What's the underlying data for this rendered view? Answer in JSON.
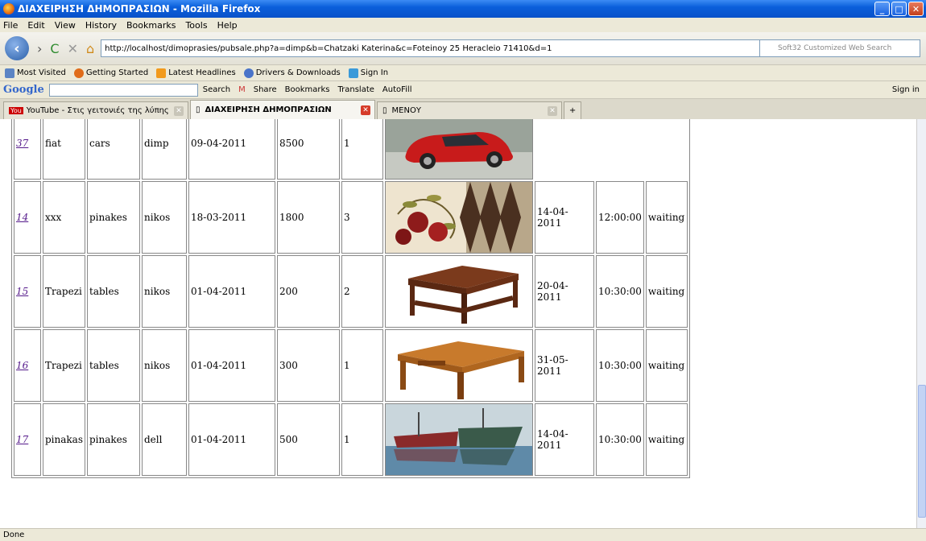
{
  "window": {
    "title": "ΔΙΑΧΕΙΡΗΣΗ ΔΗΜΟΠΡΑΣΙΩΝ - Mozilla Firefox"
  },
  "menu": [
    "File",
    "Edit",
    "View",
    "History",
    "Bookmarks",
    "Tools",
    "Help"
  ],
  "url": "http://localhost/dimoprasies/pubsale.php?a=dimp&b=Chatzaki Katerina&c=Foteinoy 25 Heracleio 71410&d=1",
  "search_placeholder": "Soft32 Customized Web Search",
  "bookmarks": [
    "Most Visited",
    "Getting Started",
    "Latest Headlines",
    "Drivers & Downloads",
    "Sign In"
  ],
  "gtoolbar": {
    "logo": "Google",
    "items": [
      "Search",
      "Share",
      "Bookmarks",
      "Translate",
      "AutoFill"
    ],
    "signin": "Sign in"
  },
  "tabs": [
    {
      "label": "YouTube - Στις γειτονιές της λύπης",
      "active": false
    },
    {
      "label": "ΔΙΑΧΕΙΡΗΣΗ ΔΗΜΟΠΡΑΣΙΩΝ",
      "active": true
    },
    {
      "label": "ΜΕΝΟΥ",
      "active": false
    }
  ],
  "status": "Done",
  "rows": [
    {
      "id": "37",
      "name": "fiat",
      "category": "cars",
      "user": "dimp",
      "date": "09-04-2011",
      "price": "8500",
      "qty": "1",
      "image": "red-car",
      "end_date": "",
      "end_time": "",
      "state": ""
    },
    {
      "id": "14",
      "name": "xxx",
      "category": "pinakes",
      "user": "nikos",
      "date": "18-03-2011",
      "price": "1800",
      "qty": "3",
      "image": "pomegranate-painting",
      "end_date": "14-04-2011",
      "end_time": "12:00:00",
      "state": "waiting"
    },
    {
      "id": "15",
      "name": "Trapezi",
      "category": "tables",
      "user": "nikos",
      "date": "01-04-2011",
      "price": "200",
      "qty": "2",
      "image": "coffee-table-dark",
      "end_date": "20-04-2011",
      "end_time": "10:30:00",
      "state": "waiting"
    },
    {
      "id": "16",
      "name": "Trapezi",
      "category": "tables",
      "user": "nikos",
      "date": "01-04-2011",
      "price": "300",
      "qty": "1",
      "image": "coffee-table-light",
      "end_date": "31-05-2011",
      "end_time": "10:30:00",
      "state": "waiting"
    },
    {
      "id": "17",
      "name": "pinakas",
      "category": "pinakes",
      "user": "dell",
      "date": "01-04-2011",
      "price": "500",
      "qty": "1",
      "image": "boats-painting",
      "end_date": "14-04-2011",
      "end_time": "10:30:00",
      "state": "waiting"
    }
  ]
}
